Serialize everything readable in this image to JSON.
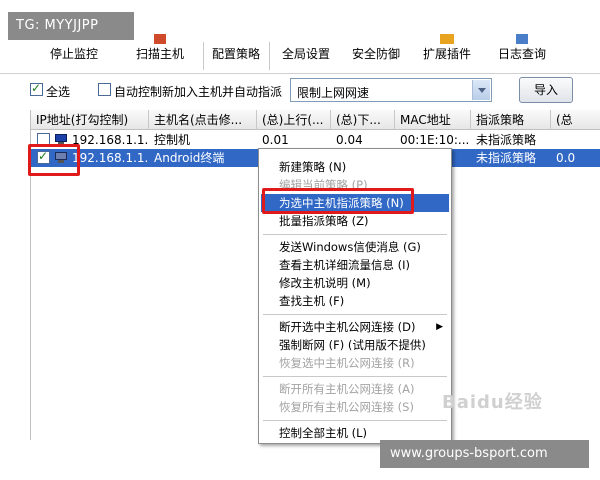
{
  "watermark_top": "TG: MYYJJPP",
  "watermark_bottom": "www.groups-bsport.com",
  "watermark_logo": "Baidu经验",
  "toolbar": {
    "buttons": [
      "停止监控",
      "扫描主机",
      "配置策略",
      "全局设置",
      "安全防御",
      "扩展插件",
      "日志查询"
    ]
  },
  "options": {
    "select_all_label": "全选",
    "select_all_checked": true,
    "auto_control_label": "自动控制新加入主机并自动指派",
    "auto_control_checked": false,
    "mode_select_value": "限制上网网速",
    "import_button": "导入"
  },
  "table": {
    "columns": [
      "IP地址(打勾控制)",
      "主机名(点击修...",
      "(总)上行(...",
      "(总)下...",
      "MAC地址",
      "指派策略",
      "(总"
    ],
    "rows": [
      {
        "checked": false,
        "ip": "192.168.1.1...",
        "host": "控制机",
        "up": "0.01",
        "down": "0.04",
        "mac": "00:1E:10:...",
        "policy": "未指派策略",
        "extra": "",
        "selected": false
      },
      {
        "checked": true,
        "ip": "192.168.1.1...",
        "host": "Android终端",
        "up": "",
        "down": "",
        "mac": "",
        "policy": "未指派策略",
        "extra": "0.0",
        "selected": true
      }
    ]
  },
  "context_menu": {
    "items": [
      {
        "label": "新建策略 (N)",
        "disabled": false,
        "highlight": false,
        "submenu": false
      },
      {
        "label": "编辑当前策略 (P)",
        "disabled": true,
        "highlight": false,
        "submenu": false
      },
      {
        "label": "为选中主机指派策略 (N)",
        "disabled": false,
        "highlight": true,
        "submenu": false
      },
      {
        "label": "批量指派策略 (Z)",
        "disabled": false,
        "highlight": false,
        "submenu": false
      },
      {
        "label": "发送Windows信使消息 (G)",
        "disabled": false,
        "highlight": false,
        "submenu": false
      },
      {
        "label": "查看主机详细流量信息 (I)",
        "disabled": false,
        "highlight": false,
        "submenu": false
      },
      {
        "label": "修改主机说明 (M)",
        "disabled": false,
        "highlight": false,
        "submenu": false
      },
      {
        "label": "查找主机 (F)",
        "disabled": false,
        "highlight": false,
        "submenu": false
      },
      {
        "label": "断开选中主机公网连接 (D)",
        "disabled": false,
        "highlight": false,
        "submenu": true
      },
      {
        "label": "强制断网 (F) (试用版不提供)",
        "disabled": false,
        "highlight": false,
        "submenu": false
      },
      {
        "label": "恢复选中主机公网连接 (R)",
        "disabled": true,
        "highlight": false,
        "submenu": false
      },
      {
        "label": "断开所有主机公网连接 (A)",
        "disabled": true,
        "highlight": false,
        "submenu": false
      },
      {
        "label": "恢复所有主机公网连接 (S)",
        "disabled": true,
        "highlight": false,
        "submenu": false
      },
      {
        "label": "控制全部主机 (L)",
        "disabled": false,
        "highlight": false,
        "submenu": false
      }
    ]
  },
  "colors": {
    "selection": "#3168c6",
    "annotation_red": "#e01a1a",
    "disabled_text": "#a3a3a3"
  }
}
